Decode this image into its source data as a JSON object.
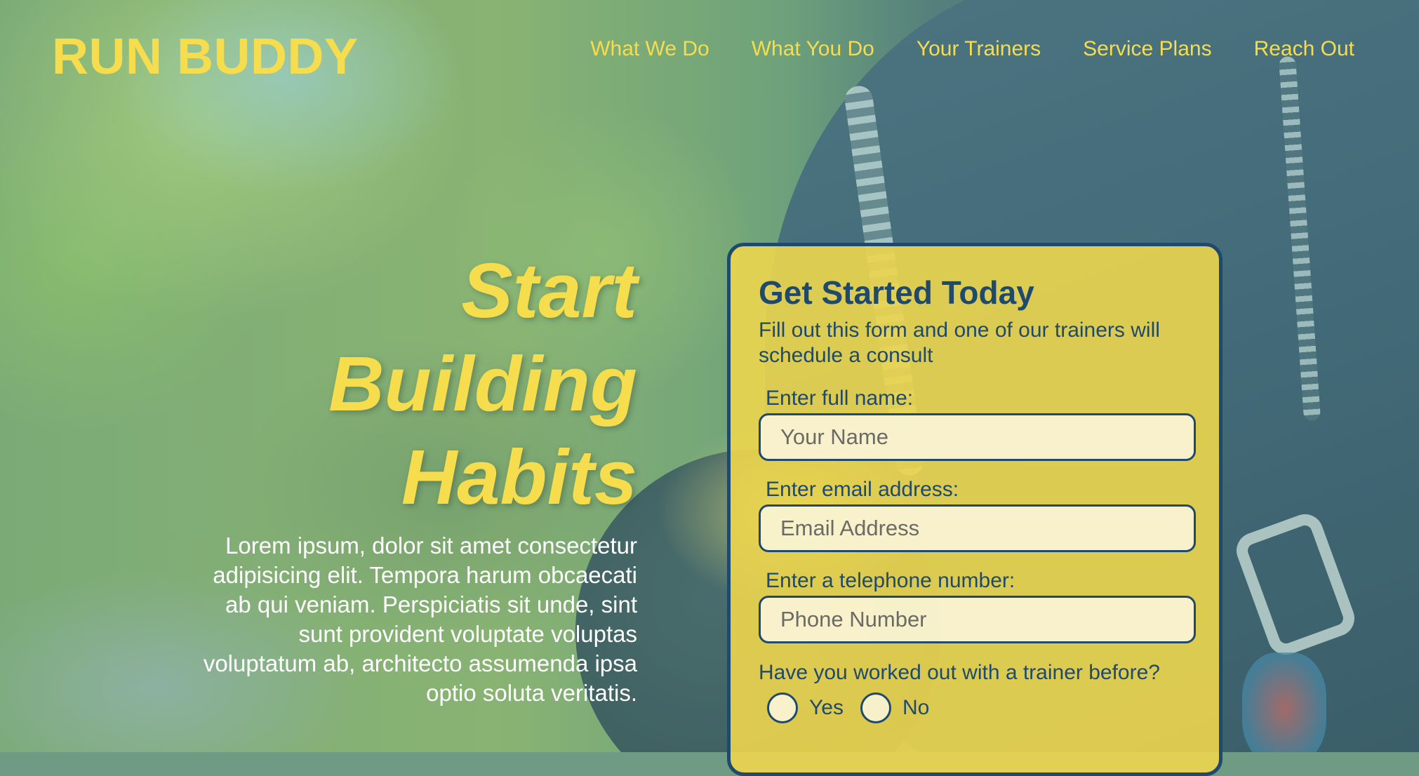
{
  "brand": {
    "logo": "RUN BUDDY"
  },
  "nav": {
    "items": [
      {
        "label": "What We Do"
      },
      {
        "label": "What You Do"
      },
      {
        "label": "Your Trainers"
      },
      {
        "label": "Service Plans"
      },
      {
        "label": "Reach Out"
      }
    ]
  },
  "hero": {
    "title_lines": [
      "Start",
      "Building",
      "Habits"
    ],
    "body": "Lorem ipsum, dolor sit amet consectetur adipisicing elit. Tempora harum obcaecati ab qui veniam. Perspiciatis sit unde, sint sunt provident voluptate voluptas voluptatum ab, architecto assumenda ipsa optio soluta veritatis."
  },
  "form": {
    "title": "Get Started Today",
    "subtitle": "Fill out this form and one of our trainers will schedule a consult",
    "fields": [
      {
        "label": "Enter full name:",
        "placeholder": "Your Name",
        "value": ""
      },
      {
        "label": "Enter email address:",
        "placeholder": "Email Address",
        "value": ""
      },
      {
        "label": "Enter a telephone number:",
        "placeholder": "Phone Number",
        "value": ""
      }
    ],
    "question": "Have you worked out with a trainer before?",
    "options": [
      {
        "label": "Yes",
        "checked": false
      },
      {
        "label": "No",
        "checked": false
      }
    ]
  },
  "colors": {
    "accent_yellow": "#f5dd4e",
    "navy": "#1f4a6d",
    "form_background": "#edd64e"
  }
}
